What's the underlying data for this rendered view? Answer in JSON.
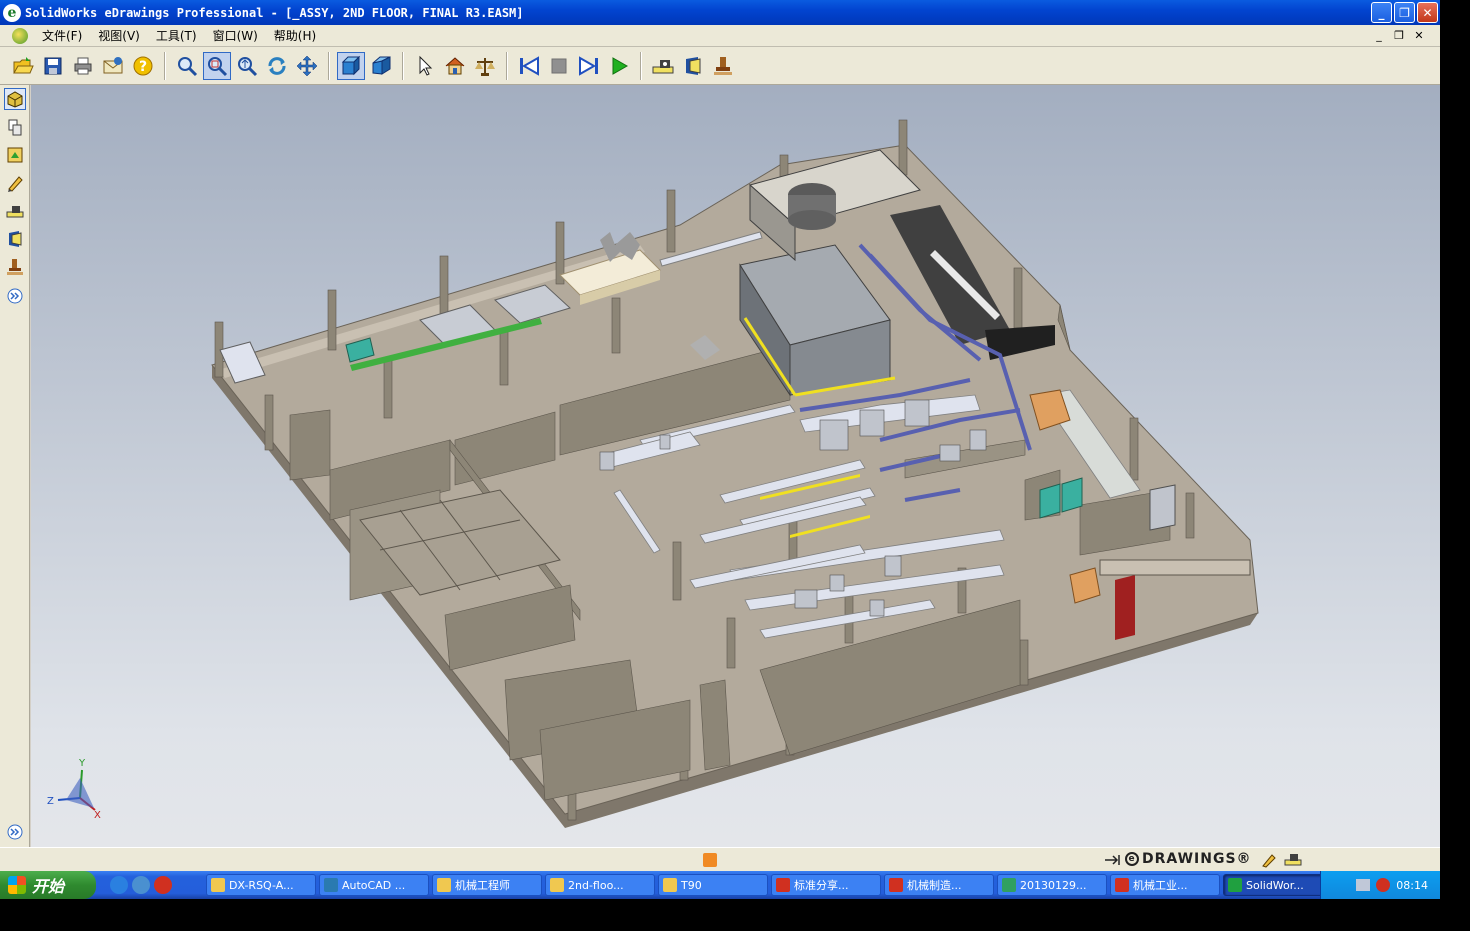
{
  "window": {
    "title": "SolidWorks eDrawings Professional - [_ASSY, 2ND FLOOR, FINAL R3.EASM]",
    "minimize": "_",
    "maximize": "❐",
    "close": "✕"
  },
  "menu": {
    "items": [
      "文件(F)",
      "视图(V)",
      "工具(T)",
      "窗口(W)",
      "帮助(H)"
    ],
    "mdi_minimize": "_",
    "mdi_restore": "❐",
    "mdi_close": "✕"
  },
  "toolbar": {
    "buttons": [
      {
        "name": "open-icon",
        "color": "#f0c020"
      },
      {
        "name": "save-icon",
        "color": "#2a5ab0"
      },
      {
        "name": "print-icon",
        "color": "#707070"
      },
      {
        "name": "send-icon",
        "color": "#d8a030"
      },
      {
        "name": "help-icon",
        "color": "#f0c000"
      },
      {
        "name": "zoom-to-fit-icon",
        "color": "#3070c0"
      },
      {
        "name": "zoom-to-area-icon",
        "color": "#3070c0"
      },
      {
        "name": "zoom-in-out-icon",
        "color": "#3070c0"
      },
      {
        "name": "rotate-icon",
        "color": "#2a80c0"
      },
      {
        "name": "pan-icon",
        "color": "#2a70c0"
      },
      {
        "name": "shaded-icon",
        "color": "#2a80d0"
      },
      {
        "name": "perspective-icon",
        "color": "#2a80d0"
      },
      {
        "name": "select-icon",
        "color": "#303030"
      },
      {
        "name": "home-icon",
        "color": "#d06020"
      },
      {
        "name": "measure-scale-icon",
        "color": "#806020"
      },
      {
        "name": "first-frame-icon",
        "color": "#2050c0"
      },
      {
        "name": "stop-icon",
        "color": "#909090"
      },
      {
        "name": "next-frame-icon",
        "color": "#2050c0"
      },
      {
        "name": "play-icon",
        "color": "#20a020"
      },
      {
        "name": "measure-icon",
        "color": "#404040"
      },
      {
        "name": "section-icon",
        "color": "#2050a0"
      },
      {
        "name": "stamp-icon",
        "color": "#a06020"
      }
    ]
  },
  "leftpanel": {
    "buttons": [
      "components-icon",
      "sheets-icon",
      "configurations-icon",
      "markup-icon",
      "measure-icon",
      "section-icon",
      "stamp-icon",
      "expand-icon"
    ],
    "collapse": "»"
  },
  "viewport": {
    "colors": {
      "floor": "#b3aa9c",
      "floor_side": "#7f776b",
      "wall": "#8d8677",
      "wall_top": "#c9c0b2",
      "machine_dark": "#858a90",
      "machine_top": "#a5aab0",
      "conveyor": "#dfe3ee",
      "blue_pipe": "#5860b0",
      "yellow": "#f0e020",
      "green": "#40b040",
      "teal": "#3ab0a0"
    },
    "triad": {
      "x": "X",
      "y": "Y",
      "z": "Z"
    }
  },
  "statusbar": {
    "brand": "DRAWINGS®"
  },
  "taskbar": {
    "start": "开始",
    "tasks": [
      {
        "label": "DX-RSQ-A...",
        "icon": "folder",
        "color": "#f0c850"
      },
      {
        "label": "AutoCAD ...",
        "icon": "autocad",
        "color": "#2a7ab0"
      },
      {
        "label": "机械工程师",
        "icon": "folder",
        "color": "#f0c850"
      },
      {
        "label": "2nd-floo...",
        "icon": "folder",
        "color": "#f0c850"
      },
      {
        "label": "T90",
        "icon": "folder",
        "color": "#f0c850"
      },
      {
        "label": "标准分享...",
        "icon": "pdf",
        "color": "#d03020"
      },
      {
        "label": "机械制造...",
        "icon": "pdf",
        "color": "#d03020"
      },
      {
        "label": "20130129...",
        "icon": "image",
        "color": "#30a060"
      },
      {
        "label": "机械工业...",
        "icon": "pdf",
        "color": "#d03020"
      },
      {
        "label": "SolidWor...",
        "icon": "edrawings",
        "color": "#20a040"
      }
    ],
    "clock": "08:14"
  }
}
